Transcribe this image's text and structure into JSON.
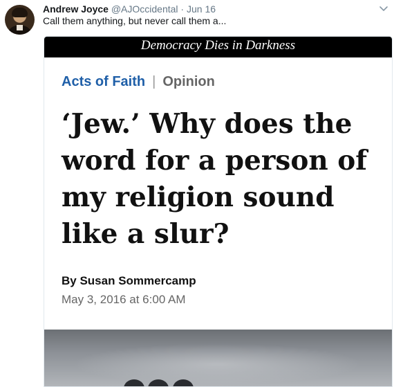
{
  "tweet": {
    "author_name": "Andrew Joyce",
    "author_handle": "@AJOccidental",
    "separator": "·",
    "date": "Jun 16",
    "text": "Call them anything, but never call them a..."
  },
  "card": {
    "masthead": "Democracy Dies in Darkness",
    "section": "Acts of Faith",
    "divider": "|",
    "category": "Opinion",
    "headline": "‘Jew.’ Why does the word for a person of my religion sound like a slur?",
    "byline": "By Susan Sommercamp",
    "published": "May 3, 2016 at 6:00 AM"
  },
  "colors": {
    "section_blue": "#1f5fa8",
    "masthead_bg": "#000000",
    "muted_gray": "#657786"
  },
  "icons": {
    "menu": "chevron-down-icon",
    "avatar": "avatar-portrait"
  }
}
